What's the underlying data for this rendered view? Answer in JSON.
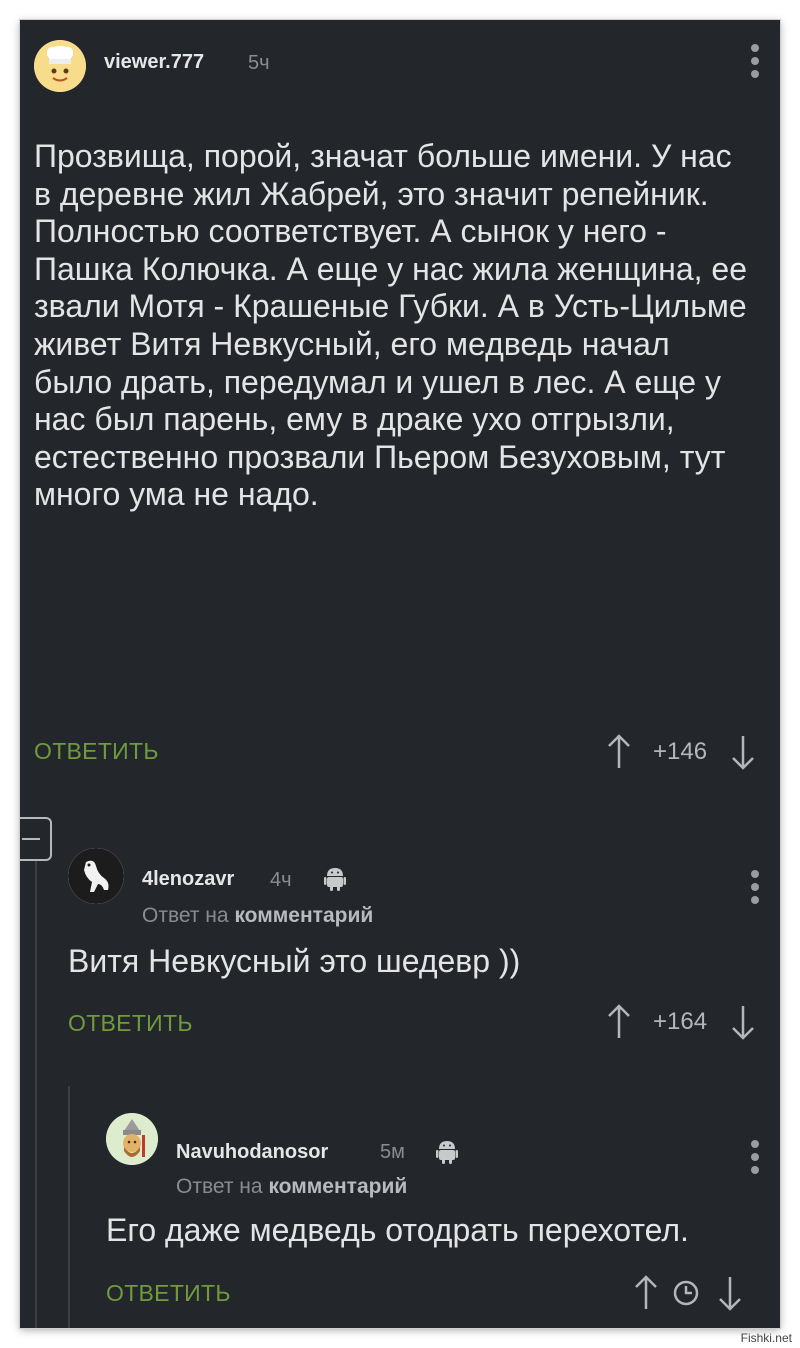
{
  "comments": [
    {
      "username": "viewer.777",
      "time": "5ч",
      "text": "Прозвища, порой, значат больше имени. У нас в деревне жил Жабрей, это значит репейник. Полностью соответствует. А сынок у него - Пашка Колючка. А еще у нас жила женщина, ее звали Мотя - Крашеные Губки. А в Усть-Цильме живет Витя Невкусный, его медведь начал было драть, передумал и ушел в лес. А еще у нас был парень, ему в драке ухо отгрызли, естественно прозвали Пьером Безуховым, тут много ума не надо.",
      "reply_label": "ОТВЕТИТЬ",
      "score": "+146"
    },
    {
      "username": "4lenozavr",
      "time": "4ч",
      "reply_prefix": "Ответ на",
      "reply_target": "комментарий",
      "text": "Витя Невкусный это шедевр ))",
      "reply_label": "ОТВЕТИТЬ",
      "score": "+164"
    },
    {
      "username": "Navuhodanosor",
      "time": "5м",
      "reply_prefix": "Ответ на",
      "reply_target": "комментарий",
      "text": "Его даже медведь отодрать перехотел.",
      "reply_label": "ОТВЕТИТЬ"
    }
  ],
  "watermark": "Fishki.net",
  "colors": {
    "background": "#23262a",
    "accent_green": "#6f9b3e",
    "text": "#e4e4e4",
    "muted": "#8a8d90"
  },
  "icons": [
    "avatar",
    "more-vert-icon",
    "android-icon",
    "arrow-up-icon",
    "arrow-down-icon",
    "clock-icon",
    "collapse-icon"
  ]
}
